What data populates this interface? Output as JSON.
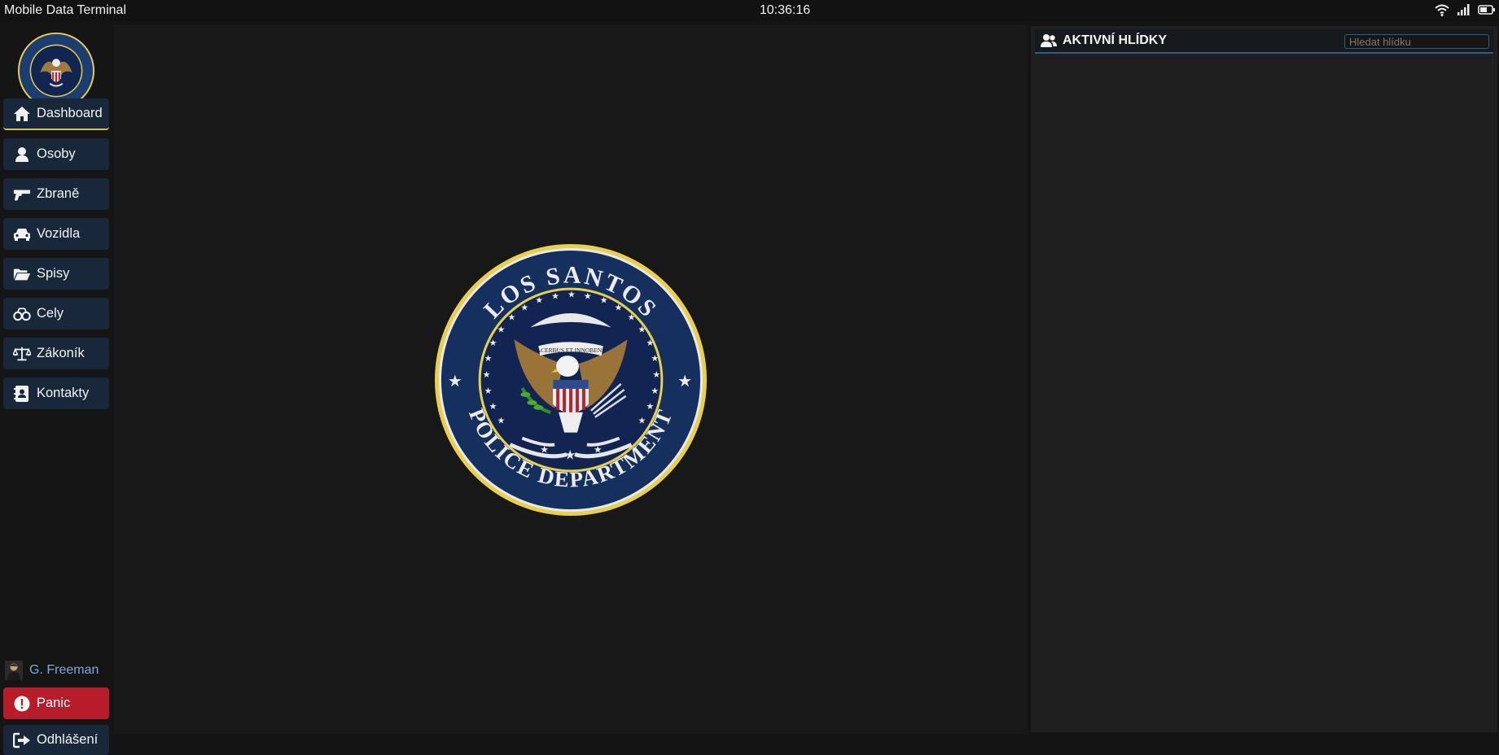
{
  "statusbar": {
    "app_title": "Mobile Data Terminal",
    "time": "10:36:16",
    "icons": [
      "wifi-icon",
      "signal-icon",
      "battery-icon"
    ]
  },
  "sidebar": {
    "logo_text_top": "LOS SANTOS",
    "logo_text_bottom": "POLICE DEPARTMENT",
    "items": [
      {
        "label": "Dashboard",
        "icon": "home-icon",
        "active": true
      },
      {
        "label": "Osoby",
        "icon": "user-icon"
      },
      {
        "label": "Zbraně",
        "icon": "gun-icon"
      },
      {
        "label": "Vozidla",
        "icon": "car-icon"
      },
      {
        "label": "Spisy",
        "icon": "folder-open-icon"
      },
      {
        "label": "Cely",
        "icon": "handcuffs-icon"
      },
      {
        "label": "Zákoník",
        "icon": "scales-icon"
      },
      {
        "label": "Kontakty",
        "icon": "address-book-icon"
      }
    ],
    "user": {
      "name": "G. Freeman"
    },
    "panic_label": "Panic",
    "logout_label": "Odhlášení"
  },
  "seal": {
    "top_text": "LOS SANTOS",
    "bottom_text": "POLICE DEPARTMENT",
    "motto": "ACERBUS ET INNOBENS"
  },
  "right_panel": {
    "title": "AKTIVNÍ HLÍDKY",
    "search_placeholder": "Hledat hlídku"
  },
  "colors": {
    "nav_bg": "#18283a",
    "active_underline": "#d6c44a",
    "panic_red": "#b71c2b",
    "accent_blue": "#2a5f86",
    "seal_gold": "#e8d04a",
    "seal_navy": "#14305e"
  }
}
